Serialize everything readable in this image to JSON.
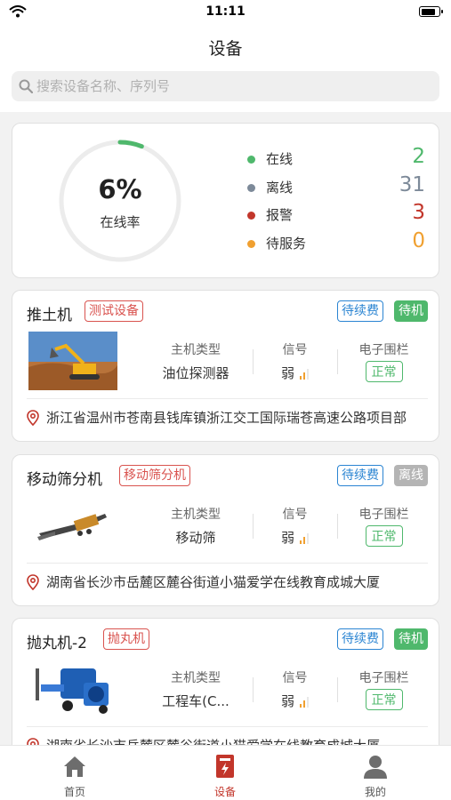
{
  "status_bar": {
    "time": "11:11"
  },
  "nav": {
    "title": "设备"
  },
  "search": {
    "placeholder": "搜索设备名称、序列号"
  },
  "summary": {
    "online_rate_text": "6%",
    "online_rate_fraction": 0.06,
    "online_rate_label": "在线率",
    "legend": [
      {
        "label": "在线",
        "count": "2",
        "color": "#4fb86c"
      },
      {
        "label": "离线",
        "count": "31",
        "color": "#7d8a99"
      },
      {
        "label": "报警",
        "count": "3",
        "color": "#c2362b"
      },
      {
        "label": "待服务",
        "count": "0",
        "color": "#f0a030"
      }
    ]
  },
  "device_columns": {
    "type": "主机类型",
    "signal": "信号",
    "fence": "电子围栏"
  },
  "devices": [
    {
      "name": "推土机",
      "tag": "测试设备",
      "fee": "待续费",
      "state": "待机",
      "state_color": "#4fb86c",
      "host_type": "油位探测器",
      "signal": "弱",
      "fence": "正常",
      "address": "浙江省温州市苍南县钱库镇浙江交工国际瑞苍高速公路项目部"
    },
    {
      "name": "移动筛分机",
      "tag": "移动筛分机",
      "fee": "待续费",
      "state": "离线",
      "state_color": "#b4b4b4",
      "host_type": "移动筛",
      "signal": "弱",
      "fence": "正常",
      "address": "湖南省长沙市岳麓区麓谷街道小猫爱学在线教育成城大厦"
    },
    {
      "name": "抛丸机-2",
      "tag": "抛丸机",
      "fee": "待续费",
      "state": "待机",
      "state_color": "#4fb86c",
      "host_type": "工程车(C...",
      "signal": "弱",
      "fence": "正常",
      "address": "湖南省长沙市岳麓区麓谷街道小猫爱学在线教育成城大厦"
    }
  ],
  "tabs": [
    {
      "label": "首页",
      "icon": "home-icon"
    },
    {
      "label": "设备",
      "icon": "device-icon"
    },
    {
      "label": "我的",
      "icon": "profile-icon"
    }
  ]
}
